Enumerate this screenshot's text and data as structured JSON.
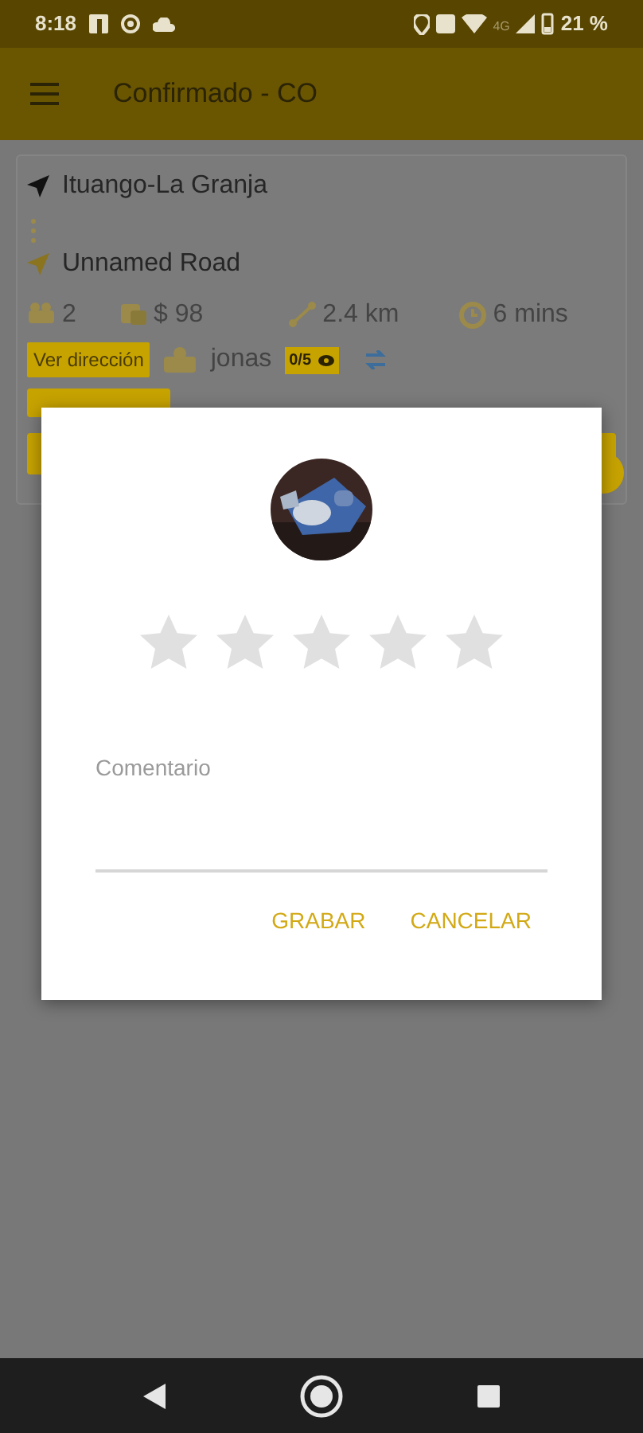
{
  "status_bar": {
    "time": "8:18",
    "network": "4G",
    "battery": "21 %"
  },
  "app_bar": {
    "title": "Confirmado - CO"
  },
  "trip": {
    "origin": "Ituango-La Granja",
    "destination": "Unnamed Road",
    "stats": [
      {
        "kind": "seats",
        "value": "2"
      },
      {
        "kind": "price",
        "value": "$ 98"
      },
      {
        "kind": "distance",
        "value": "2.4 km"
      },
      {
        "kind": "time",
        "value": "6 mins"
      }
    ],
    "address_button": "Ver dirección",
    "driver": "jonas",
    "rating_badge": "0/5"
  },
  "dialog": {
    "stars": 0,
    "comment": {
      "placeholder": "Comentario"
    },
    "buttons": [
      "GRABAR",
      "CANCELAR"
    ]
  }
}
